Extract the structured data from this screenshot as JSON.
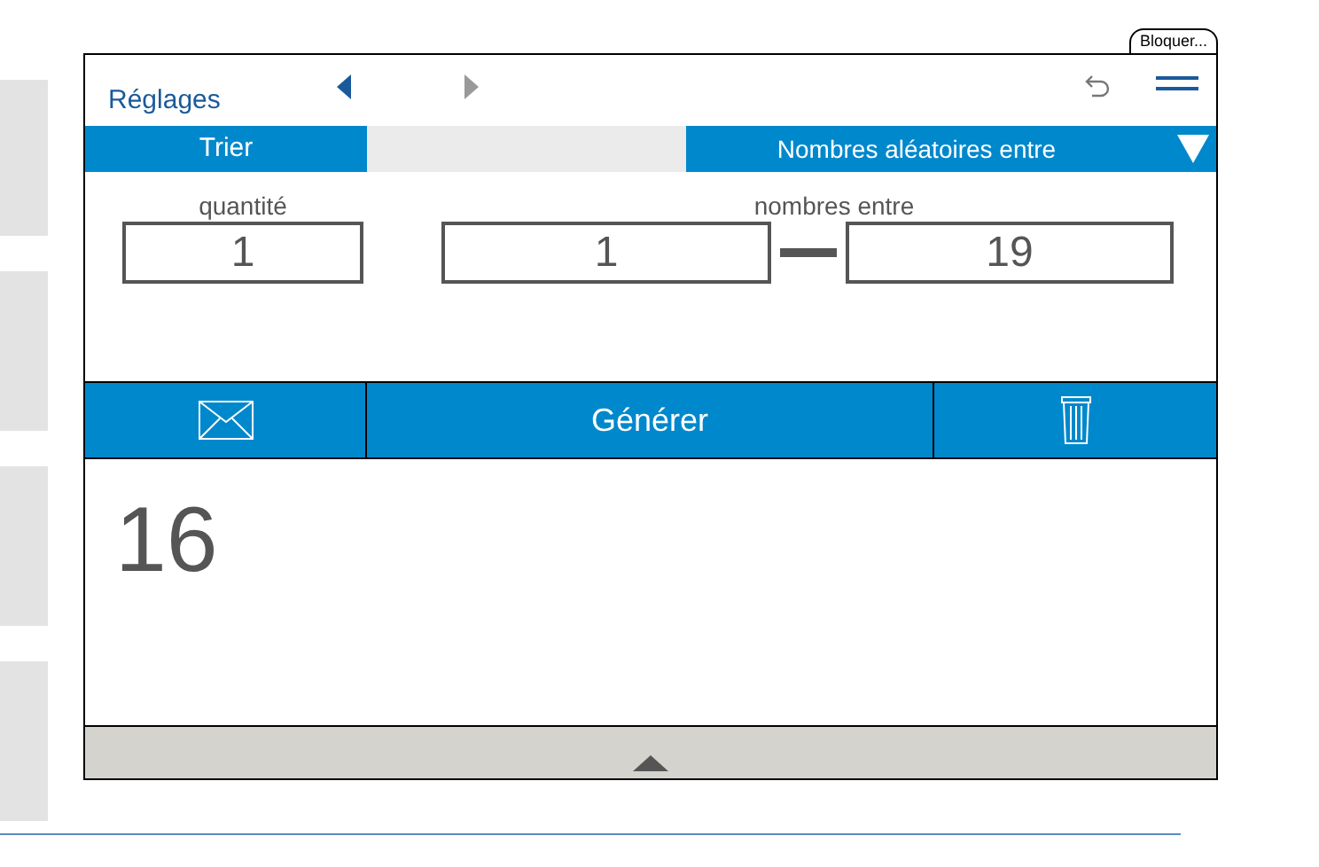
{
  "lock_tab": {
    "label": "Bloquer..."
  },
  "header": {
    "title": "Réglages"
  },
  "tabs": [
    {
      "label": "Trier",
      "selected": true
    },
    {
      "label": "Nombres aléatoires entre",
      "selected": true
    }
  ],
  "fields": {
    "quantity": {
      "label": "quantité",
      "value": "1"
    },
    "range": {
      "label": "nombres entre",
      "from": "1",
      "to": "19"
    }
  },
  "actions": {
    "generate": "Générer"
  },
  "result": "16"
}
